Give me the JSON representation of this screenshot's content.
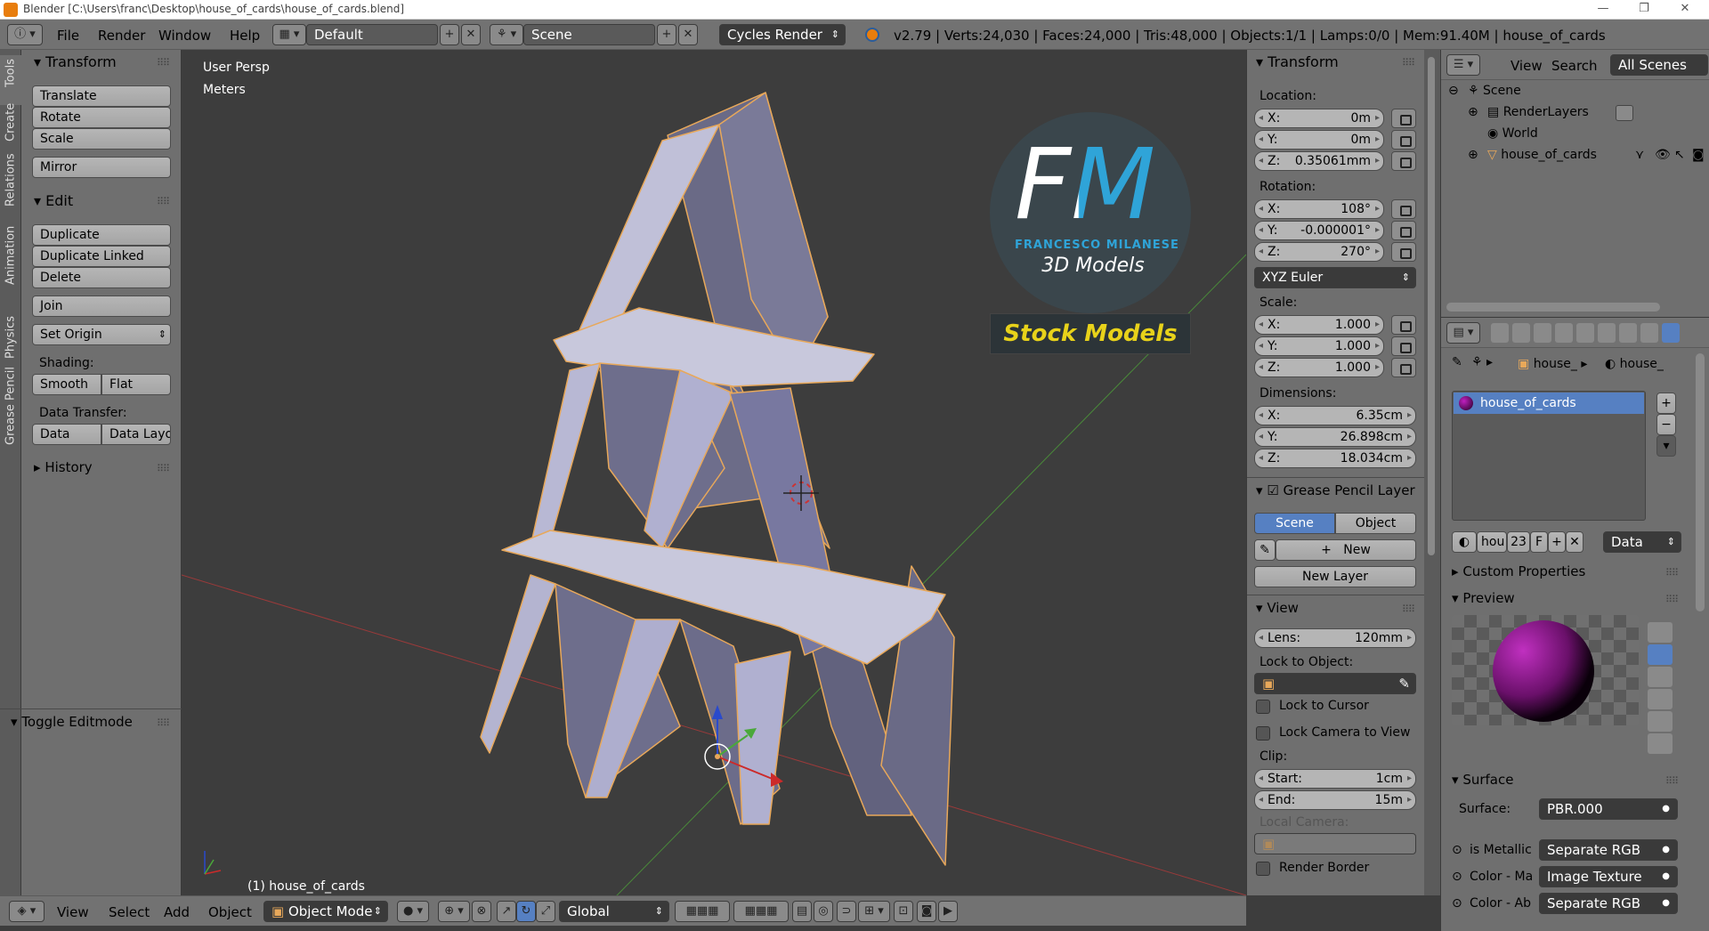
{
  "window": {
    "title": "Blender [C:\\Users\\franc\\Desktop\\house_of_cards\\house_of_cards.blend]",
    "controls": [
      "—",
      "❐",
      "✕"
    ]
  },
  "info_header": {
    "menus": [
      "File",
      "Render",
      "Window",
      "Help"
    ],
    "screen_layout": "Default",
    "scene": "Scene",
    "render_engine": "Cycles Render",
    "stats": "v2.79 | Verts:24,030 | Faces:24,000 | Tris:48,000 | Objects:1/1 | Lamps:0/0 | Mem:91.40M | house_of_cards"
  },
  "left_tabs": [
    "Tools",
    "Create",
    "Relations",
    "Animation",
    "Physics",
    "Grease Pencil"
  ],
  "tool_shelf": {
    "transform_header": "Transform",
    "transform_buttons": [
      "Translate",
      "Rotate",
      "Scale",
      "Mirror"
    ],
    "edit_header": "Edit",
    "edit_buttons": [
      "Duplicate",
      "Duplicate Linked",
      "Delete",
      "Join"
    ],
    "set_origin": "Set Origin",
    "shading_label": "Shading:",
    "smooth": "Smooth",
    "flat": "Flat",
    "data_transfer_label": "Data Transfer:",
    "data": "Data",
    "data_layout": "Data Layo",
    "history_header": "History",
    "toggle_editmode": "Toggle Editmode"
  },
  "viewport": {
    "view_name": "User Persp",
    "units": "Meters",
    "object_label": "(1) house_of_cards",
    "logo": {
      "letters": "FM",
      "name": "FRANCESCO MILANESE",
      "subtitle": "3D Models",
      "banner": "Stock Models"
    }
  },
  "n_panel": {
    "transform_header": "Transform",
    "location_label": "Location:",
    "location": [
      {
        "axis": "X:",
        "value": "0m"
      },
      {
        "axis": "Y:",
        "value": "0m"
      },
      {
        "axis": "Z:",
        "value": "0.35061mm"
      }
    ],
    "rotation_label": "Rotation:",
    "rotation": [
      {
        "axis": "X:",
        "value": "108°"
      },
      {
        "axis": "Y:",
        "value": "-0.000001°"
      },
      {
        "axis": "Z:",
        "value": "270°"
      }
    ],
    "rotation_mode": "XYZ Euler",
    "scale_label": "Scale:",
    "scale": [
      {
        "axis": "X:",
        "value": "1.000"
      },
      {
        "axis": "Y:",
        "value": "1.000"
      },
      {
        "axis": "Z:",
        "value": "1.000"
      }
    ],
    "dimensions_label": "Dimensions:",
    "dimensions": [
      {
        "axis": "X:",
        "value": "6.35cm"
      },
      {
        "axis": "Y:",
        "value": "26.898cm"
      },
      {
        "axis": "Z:",
        "value": "18.034cm"
      }
    ],
    "grease_pencil_header": "Grease Pencil Layer",
    "gp_scene": "Scene",
    "gp_object": "Object",
    "gp_new": "New",
    "gp_new_layer": "New Layer",
    "view_header": "View",
    "lens_label": "Lens:",
    "lens_value": "120mm",
    "lock_to_object_label": "Lock to Object:",
    "lock_to_cursor": "Lock to Cursor",
    "lock_camera_to_view": "Lock Camera to View",
    "clip_label": "Clip:",
    "clip_start_label": "Start:",
    "clip_start": "1cm",
    "clip_end_label": "End:",
    "clip_end": "15m",
    "local_camera_label": "Local Camera:",
    "render_border": "Render Border"
  },
  "outliner": {
    "menus": [
      "View",
      "Search"
    ],
    "filter": "All Scenes",
    "items": [
      "Scene",
      "RenderLayers",
      "World",
      "house_of_cards"
    ]
  },
  "properties": {
    "breadcrumb": [
      "house_",
      "house_"
    ],
    "material_slot": "house_of_cards",
    "datablock_short": "hou",
    "user_count": "23",
    "fake_user": "F",
    "link": "Data",
    "custom_properties": "Custom Properties",
    "preview_header": "Preview",
    "surface_header": "Surface",
    "surface_label": "Surface:",
    "surface_value": "PBR.000",
    "inputs": [
      {
        "label": "is Metallic",
        "value": "Separate RGB"
      },
      {
        "label": "Color - Ma",
        "value": "Image Texture"
      },
      {
        "label": "Color - Ab",
        "value": "Separate RGB"
      }
    ]
  },
  "bottom_header": {
    "menus": [
      "View",
      "Select",
      "Add",
      "Object"
    ],
    "mode": "Object Mode",
    "orientation": "Global"
  },
  "colors": {
    "panel": "#6f6f6f",
    "viewport": "#3d3d3d",
    "selection": "#5680c2",
    "accent_orange": "#e87d0d",
    "logo_blue": "#2fa4d8",
    "logo_yellow": "#e8d21a"
  }
}
